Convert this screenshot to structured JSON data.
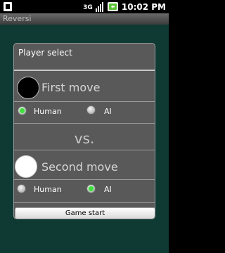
{
  "status_bar": {
    "time": "10:02 PM",
    "network_badge": "3G",
    "icons": [
      "sim-card-icon",
      "3g-icon",
      "signal-icon",
      "battery-icon"
    ]
  },
  "app": {
    "title": "Reversi"
  },
  "dialog": {
    "title": "Player select",
    "first": {
      "label": "First move",
      "stone_color": "#000000",
      "options": [
        {
          "label": "Human",
          "checked": true
        },
        {
          "label": "AI",
          "checked": false
        }
      ]
    },
    "vs": "vs.",
    "second": {
      "label": "Second move",
      "stone_color": "#ffffff",
      "options": [
        {
          "label": "Human",
          "checked": false
        },
        {
          "label": "AI",
          "checked": true
        }
      ]
    },
    "start_button": "Game start"
  },
  "colors": {
    "app_background": "#0e3a33",
    "dialog_background": "#595959",
    "radio_checked": "#3ee03e"
  }
}
